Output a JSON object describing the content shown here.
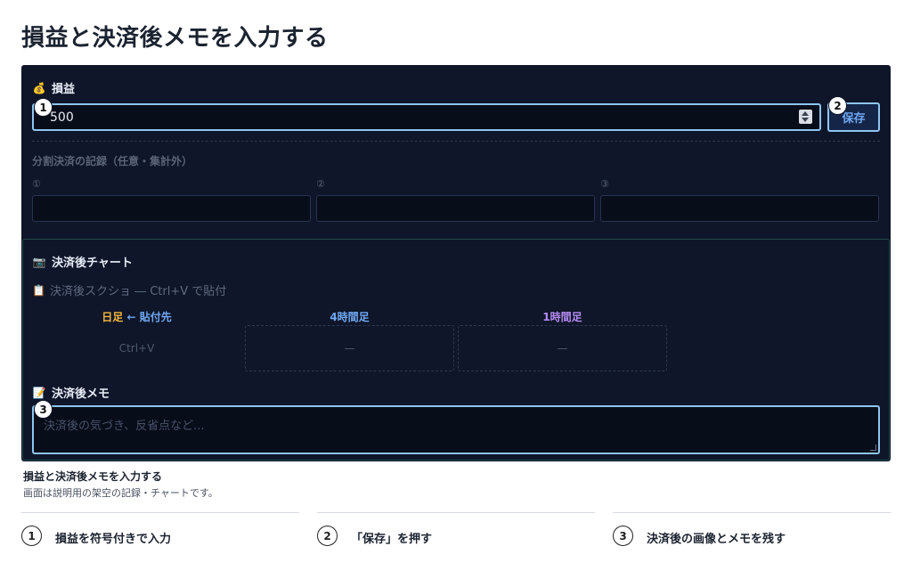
{
  "page": {
    "title": "損益と決済後メモを入力する"
  },
  "pnl": {
    "icon": "money-bag-icon",
    "label": "損益",
    "value": "500",
    "save_label": "保存"
  },
  "split": {
    "title": "分割決済の記録（任意・集計外）",
    "slots": [
      {
        "num": "①",
        "value": ""
      },
      {
        "num": "②",
        "value": ""
      },
      {
        "num": "③",
        "value": ""
      }
    ]
  },
  "chart": {
    "icon": "camera-icon",
    "label": "決済後チャート",
    "clip_icon": "clipboard-icon",
    "clip_label": "決済後スクショ ― Ctrl+V で貼付",
    "slots": [
      {
        "label": "日足",
        "suffix": "← 貼付先",
        "placeholder": "Ctrl+V",
        "color": "#f2b63c",
        "suffix_color": "#6fa8f2"
      },
      {
        "label": "4時間足",
        "suffix": "",
        "placeholder": "—",
        "color": "#6fa8f2"
      },
      {
        "label": "1時間足",
        "suffix": "",
        "placeholder": "—",
        "color": "#b58af2"
      }
    ]
  },
  "memo": {
    "icon": "memo-icon",
    "label": "決済後メモ",
    "placeholder": "決済後の気づき、反省点など..."
  },
  "badges": [
    "1",
    "2",
    "3"
  ],
  "caption": {
    "title": "損益と決済後メモを入力する",
    "subtitle": "画面は説明用の架空の記録・チャートです。"
  },
  "steps": [
    {
      "num": "1",
      "text": "損益を符号付きで入力"
    },
    {
      "num": "2",
      "text": "「保存」を押す"
    },
    {
      "num": "3",
      "text": "決済後の画像とメモを残す"
    }
  ],
  "colors": {
    "panel_bg": "#0f1629",
    "highlight": "#8ec5ee",
    "accent_blue": "#6fa8f2",
    "accent_yellow": "#f2b63c",
    "accent_purple": "#b58af2"
  }
}
